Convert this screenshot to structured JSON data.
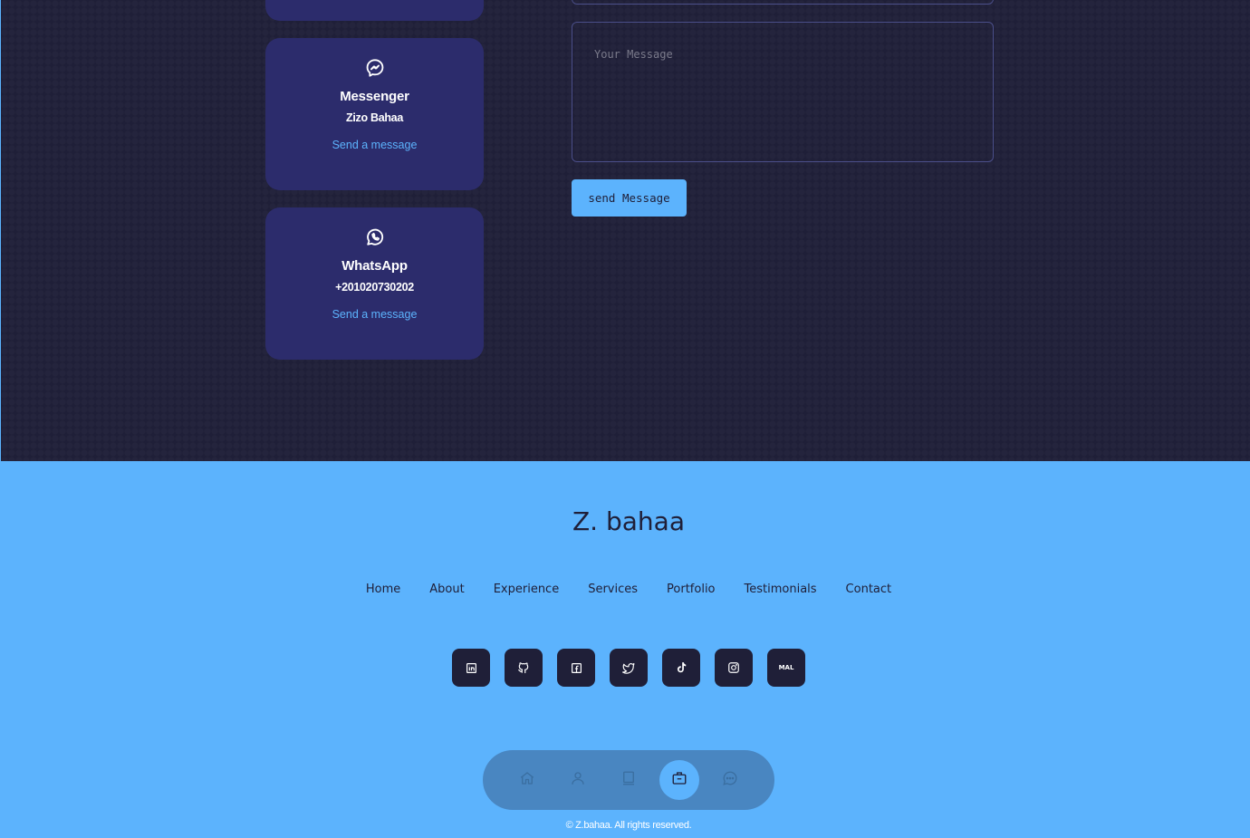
{
  "colors": {
    "background": "#1f1f38",
    "card": "#2c2c6c",
    "accent": "#5cb3fd"
  },
  "contact": {
    "cards": [
      {
        "title": "Messenger",
        "value": "Zizo Bahaa",
        "link": "Send a message",
        "icon": "messenger-icon"
      },
      {
        "title": "WhatsApp",
        "value": "+201020730202",
        "link": "Send a message",
        "icon": "whatsapp-icon"
      }
    ],
    "form": {
      "message_placeholder": "Your Message",
      "send_label": "send Message"
    }
  },
  "footer": {
    "logo": "Z. bahaa",
    "nav": [
      "Home",
      "About",
      "Experience",
      "Services",
      "Portfolio",
      "Testimonials",
      "Contact"
    ],
    "socials": [
      {
        "name": "linkedin-icon"
      },
      {
        "name": "github-icon"
      },
      {
        "name": "facebook-icon"
      },
      {
        "name": "twitter-icon"
      },
      {
        "name": "tiktok-icon"
      },
      {
        "name": "instagram-icon"
      },
      {
        "name": "mal-icon",
        "label": "MAL"
      }
    ],
    "copyright": "© Z.bahaa. All rights reserved."
  },
  "bottom_nav": {
    "items": [
      "home-icon",
      "user-icon",
      "book-icon",
      "briefcase-icon",
      "chat-icon"
    ],
    "active": "briefcase-icon"
  }
}
